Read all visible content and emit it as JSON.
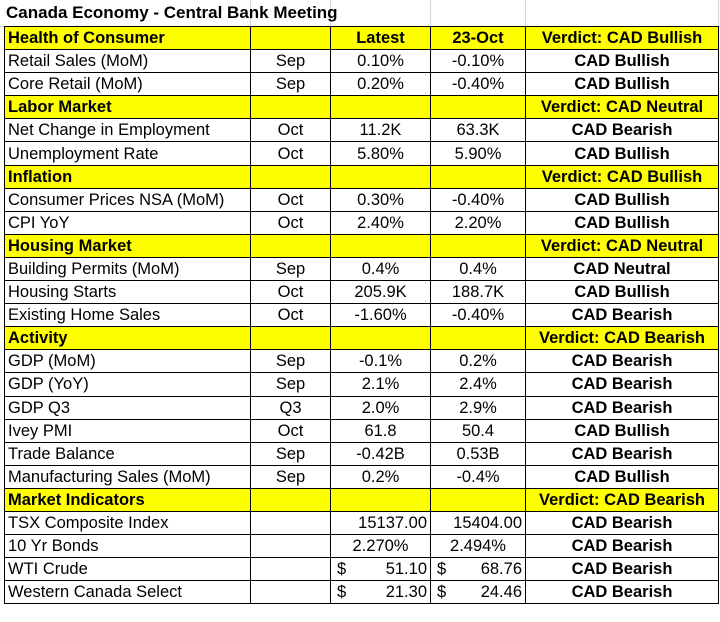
{
  "title": "Canada Economy - Central Bank Meeting",
  "colors": {
    "section_bg": "#ffff00",
    "bullish": "#1fa84a",
    "bullish_verdict": "#127a12",
    "bearish": "#ff0000",
    "neutral": "#000000"
  },
  "sections": [
    {
      "name": "Health of Consumer",
      "col_latest": "Latest",
      "col_prev": "23-Oct",
      "verdict": "Verdict: CAD Bullish",
      "verdict_tone": "bull",
      "rows": [
        {
          "name": "Retail Sales (MoM)",
          "period": "Sep",
          "latest": "0.10%",
          "prev": "-0.10%",
          "signal": "CAD Bullish",
          "tone": "bull"
        },
        {
          "name": "Core Retail (MoM)",
          "period": "Sep",
          "latest": "0.20%",
          "prev": "-0.40%",
          "signal": "CAD Bullish",
          "tone": "bull"
        }
      ]
    },
    {
      "name": "Labor Market",
      "col_latest": "",
      "col_prev": "",
      "verdict": "Verdict: CAD Neutral",
      "verdict_tone": "neutral",
      "rows": [
        {
          "name": "Net Change in Employment",
          "period": "Oct",
          "latest": "11.2K",
          "prev": "63.3K",
          "signal": "CAD Bearish",
          "tone": "bear"
        },
        {
          "name": "Unemployment Rate",
          "period": "Oct",
          "latest": "5.80%",
          "prev": "5.90%",
          "signal": "CAD Bullish",
          "tone": "bull"
        }
      ]
    },
    {
      "name": "Inflation",
      "col_latest": "",
      "col_prev": "",
      "verdict": "Verdict: CAD Bullish",
      "verdict_tone": "bull",
      "rows": [
        {
          "name": "Consumer Prices NSA (MoM)",
          "period": "Oct",
          "latest": "0.30%",
          "prev": "-0.40%",
          "signal": "CAD Bullish",
          "tone": "bull"
        },
        {
          "name": "CPI YoY",
          "period": "Oct",
          "latest": "2.40%",
          "prev": "2.20%",
          "signal": "CAD Bullish",
          "tone": "bull"
        }
      ]
    },
    {
      "name": "Housing Market",
      "col_latest": "",
      "col_prev": "",
      "verdict": "Verdict: CAD Neutral",
      "verdict_tone": "neutral",
      "rows": [
        {
          "name": "Building Permits (MoM)",
          "period": "Sep",
          "latest": "0.4%",
          "prev": "0.4%",
          "signal": "CAD Neutral",
          "tone": "neutral"
        },
        {
          "name": "Housing Starts",
          "period": "Oct",
          "latest": "205.9K",
          "prev": "188.7K",
          "signal": "CAD Bullish",
          "tone": "bull"
        },
        {
          "name": "Existing Home Sales",
          "period": "Oct",
          "latest": "-1.60%",
          "prev": "-0.40%",
          "signal": "CAD Bearish",
          "tone": "bear"
        }
      ]
    },
    {
      "name": "Activity",
      "col_latest": "",
      "col_prev": "",
      "verdict": "Verdict: CAD Bearish",
      "verdict_tone": "bear",
      "rows": [
        {
          "name": "GDP (MoM)",
          "period": "Sep",
          "latest": "-0.1%",
          "prev": "0.2%",
          "signal": "CAD Bearish",
          "tone": "bear"
        },
        {
          "name": "GDP (YoY)",
          "period": "Sep",
          "latest": "2.1%",
          "prev": "2.4%",
          "signal": "CAD Bearish",
          "tone": "bear"
        },
        {
          "name": "GDP Q3",
          "period": "Q3",
          "latest": "2.0%",
          "prev": "2.9%",
          "signal": "CAD Bearish",
          "tone": "bear"
        },
        {
          "name": "Ivey PMI",
          "period": "Oct",
          "latest": "61.8",
          "prev": "50.4",
          "signal": "CAD Bullish",
          "tone": "bull"
        },
        {
          "name": "Trade Balance",
          "period": "Sep",
          "latest": "-0.42B",
          "prev": "0.53B",
          "signal": "CAD Bearish",
          "tone": "bear"
        },
        {
          "name": "Manufacturing Sales (MoM)",
          "period": "Sep",
          "latest": "0.2%",
          "prev": "-0.4%",
          "signal": "CAD Bullish",
          "tone": "bull"
        }
      ]
    },
    {
      "name": "Market Indicators",
      "col_latest": "",
      "col_prev": "",
      "verdict": "Verdict: CAD Bearish",
      "verdict_tone": "bear",
      "rows": [
        {
          "name": "TSX Composite Index",
          "period": "",
          "latest": "15137.00",
          "prev": "15404.00",
          "signal": "CAD Bearish",
          "tone": "bear",
          "format": "right"
        },
        {
          "name": "10 Yr Bonds",
          "period": "",
          "latest": "2.270%",
          "prev": "2.494%",
          "signal": "CAD Bearish",
          "tone": "bear"
        },
        {
          "name": "WTI Crude",
          "period": "",
          "currency": "$",
          "latest": "51.10",
          "prev": "68.76",
          "signal": "CAD Bearish",
          "tone": "bear",
          "format": "dollar"
        },
        {
          "name": "Western Canada Select",
          "period": "",
          "currency": "$",
          "latest": "21.30",
          "prev": "24.46",
          "signal": "CAD Bearish",
          "tone": "bear",
          "format": "dollar"
        }
      ]
    }
  ]
}
